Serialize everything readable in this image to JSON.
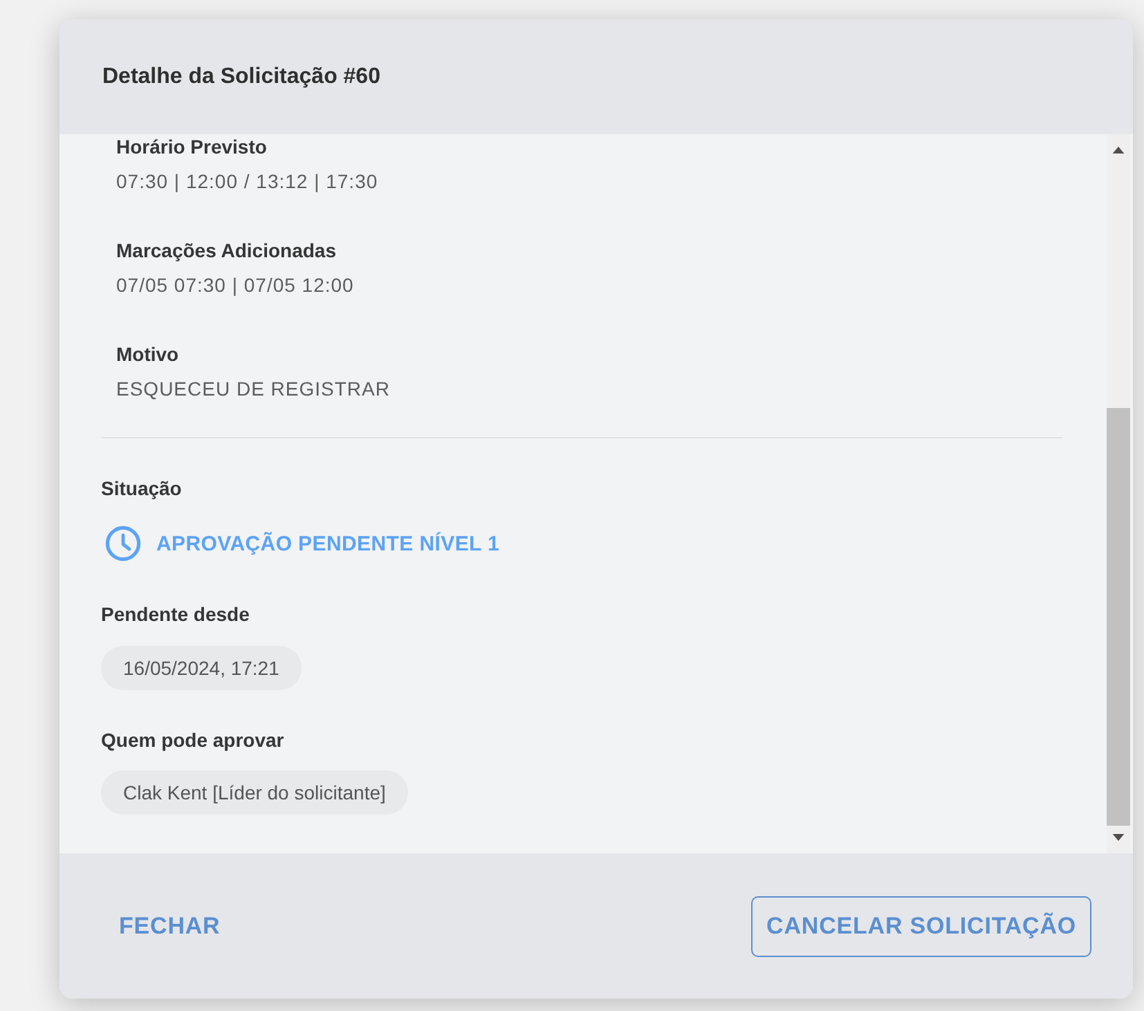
{
  "dialog": {
    "title": "Detalhe da Solicitação #60"
  },
  "details": [
    {
      "label": "Horário Previsto",
      "value": "07:30 | 12:00 / 13:12 | 17:30"
    },
    {
      "label": "Marcações Adicionadas",
      "value": "07/05 07:30 | 07/05 12:00"
    },
    {
      "label": "Motivo",
      "value": "ESQUECEU DE REGISTRAR"
    }
  ],
  "status": {
    "label": "Situação",
    "text": "APROVAÇÃO PENDENTE NÍVEL 1",
    "kind": "pending"
  },
  "fields": [
    {
      "label": "Pendente desde",
      "chip": "16/05/2024, 17:21"
    },
    {
      "label": "Quem pode aprovar",
      "chip": "Clak Kent [Líder do solicitante]"
    }
  ],
  "buttons": [
    {
      "label": "FECHAR",
      "kind": "text"
    },
    {
      "label": "CANCELAR SOLICITAÇÃO",
      "kind": "outlined"
    }
  ]
}
